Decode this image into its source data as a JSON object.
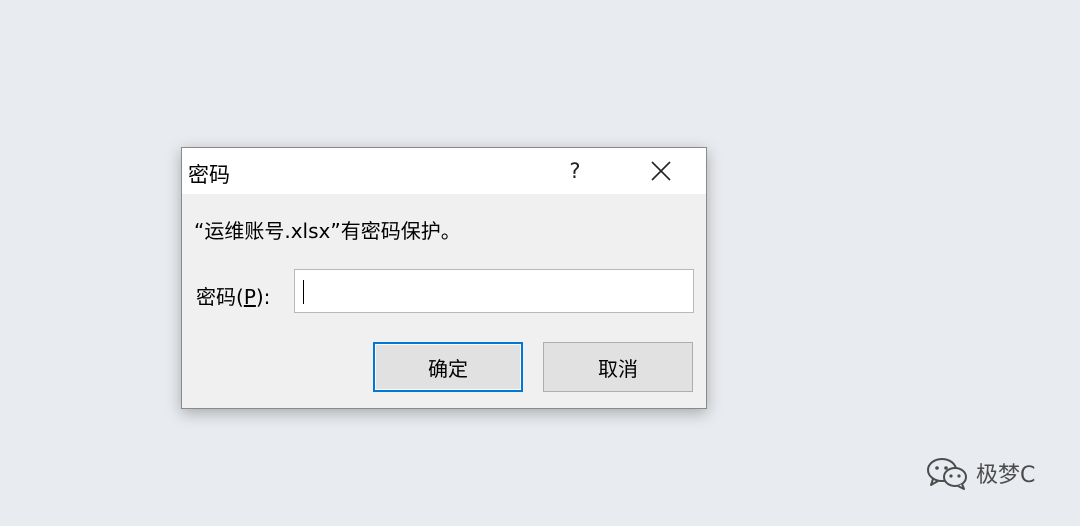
{
  "dialog": {
    "title": "密码",
    "help_label": "?",
    "message": "“运维账号.xlsx”有密码保护。",
    "password_label_prefix": "密码(",
    "password_label_key": "P",
    "password_label_suffix": "):",
    "password_value": "",
    "ok_label": "确定",
    "cancel_label": "取消"
  },
  "watermark": {
    "text": "极梦C",
    "icon": "wechat-icon"
  },
  "colors": {
    "desktop_bg": "#e8ebef",
    "dialog_bg": "#f0f0f0",
    "accent": "#0078d7"
  }
}
